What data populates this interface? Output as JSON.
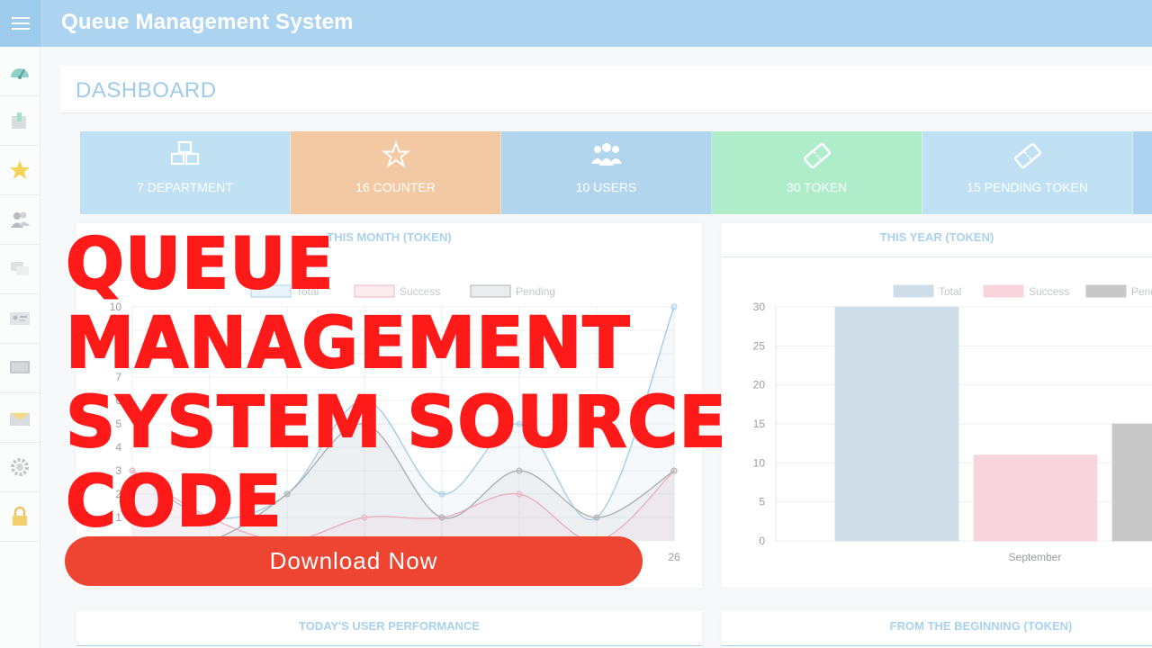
{
  "app": {
    "title": "Queue Management System"
  },
  "dashboard": {
    "title": "DASHBOARD"
  },
  "stats": [
    {
      "label": "7 DEPARTMENT",
      "icon": "cubes-icon",
      "color": "#bfe1f3"
    },
    {
      "label": "16 COUNTER",
      "icon": "star-outline-icon",
      "color": "#f3c9a3"
    },
    {
      "label": "10 USERS",
      "icon": "users-icon",
      "color": "#b2d5ee"
    },
    {
      "label": "30 TOKEN",
      "icon": "ticket-icon",
      "color": "#aeecca"
    },
    {
      "label": "15 PENDING TOKEN",
      "icon": "ticket-icon",
      "color": "#bfe1f3"
    }
  ],
  "sidebar": {
    "items": [
      {
        "icon": "dashboard-gauge-icon"
      },
      {
        "icon": "department-icon"
      },
      {
        "icon": "star-icon"
      },
      {
        "icon": "users-icon"
      },
      {
        "icon": "chat-icon"
      },
      {
        "icon": "id-card-icon"
      },
      {
        "icon": "monitor-icon"
      },
      {
        "icon": "mail-icon"
      },
      {
        "icon": "settings-gear-icon"
      },
      {
        "icon": "lock-icon"
      }
    ]
  },
  "panels": {
    "month": {
      "title": "THIS MONTH (TOKEN)"
    },
    "year": {
      "title": "THIS YEAR (TOKEN)"
    },
    "user_performance": {
      "title": "TODAY'S USER PERFORMANCE"
    },
    "beginning": {
      "title": "FROM THE BEGINNING (TOKEN)"
    }
  },
  "chart_data": [
    {
      "type": "line",
      "title": "THIS MONTH (TOKEN)",
      "legend": [
        "Total",
        "Success",
        "Pending"
      ],
      "x": [
        "",
        "",
        "",
        "",
        "",
        "",
        "",
        "26"
      ],
      "ylim": [
        0,
        10
      ],
      "yticks": [
        1,
        2,
        3,
        4,
        5,
        6,
        7,
        8,
        9,
        10
      ],
      "series": [
        {
          "name": "Total",
          "color": "#a9cfe8",
          "values": [
            3,
            1,
            2,
            6,
            2,
            5,
            1,
            10
          ]
        },
        {
          "name": "Success",
          "color": "#f2b5c4",
          "values": [
            3,
            1,
            0,
            1,
            1,
            2,
            0,
            3
          ]
        },
        {
          "name": "Pending",
          "color": "#b1b3b6",
          "values": [
            0,
            0,
            2,
            5,
            1,
            3,
            1,
            3
          ]
        }
      ]
    },
    {
      "type": "bar",
      "title": "THIS YEAR (TOKEN)",
      "categories": [
        "September"
      ],
      "ylim": [
        0,
        30
      ],
      "yticks": [
        0,
        5,
        10,
        15,
        20,
        25,
        30
      ],
      "series": [
        {
          "name": "Total",
          "color": "#cfdde8",
          "values": [
            30
          ]
        },
        {
          "name": "Success",
          "color": "#f8d4dd",
          "values": [
            11
          ]
        },
        {
          "name": "Pendi",
          "color": "#c8c8c8",
          "values": [
            15
          ]
        }
      ]
    }
  ],
  "overlay": {
    "headline": [
      "QUEUE MANAGEMENT",
      "SYSTEM SOURCE",
      "CODE"
    ],
    "download_label": "Download Now"
  }
}
